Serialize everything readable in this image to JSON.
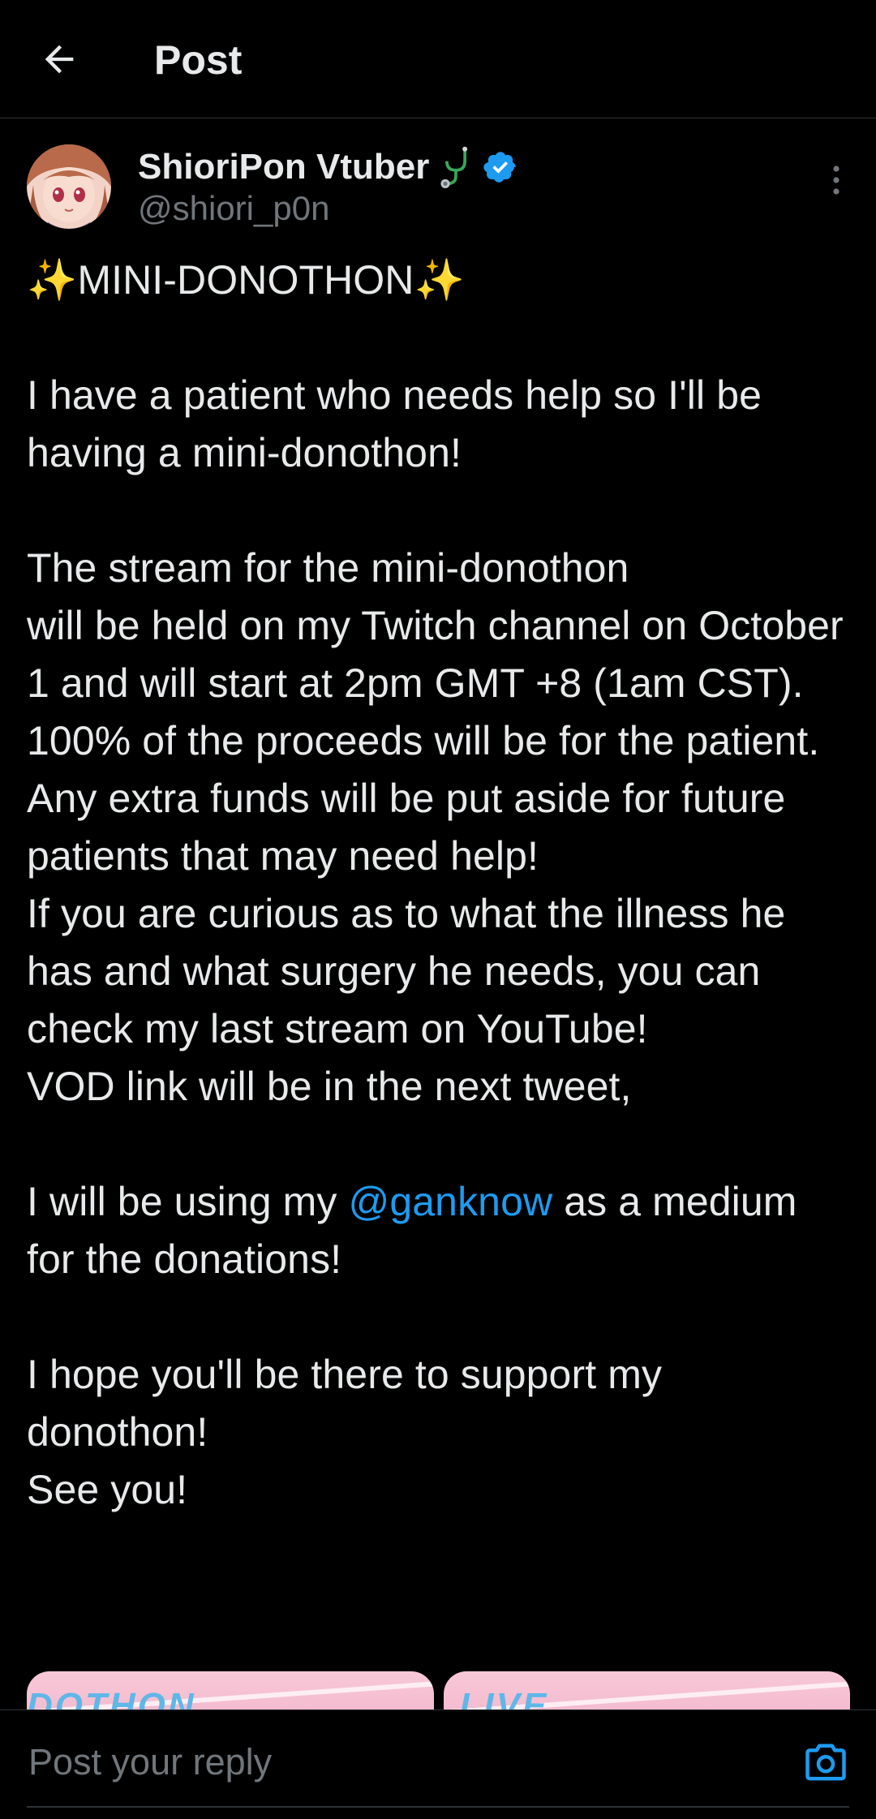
{
  "header": {
    "title": "Post",
    "back_icon": "arrow-left-icon"
  },
  "author": {
    "display_name": "ShioriPon Vtuber",
    "name_emoji": "stethoscope-icon",
    "verified_icon": "verified-badge-icon",
    "handle": "@shiori_p0n",
    "more_icon": "more-vertical-icon"
  },
  "post": {
    "p1": "✨MINI-DONOTHON✨\n\nI have a patient who needs help so I'll be having a mini-donothon!\n\nThe stream for the mini-donothon\nwill be held on my Twitch channel on October 1 and will start at 2pm GMT +8 (1am CST).\n100% of the proceeds will be for the patient. Any extra funds will be put aside for future patients that may need help!\nIf you are curious as to what the illness he has and what surgery he needs, you can check my last stream on YouTube!\nVOD link will be in the next tweet,\n\nI will be using my ",
    "mention": "@ganknow",
    "p2": " as a medium for the donations!\n\nI hope you'll be there to support my donothon!\nSee you!"
  },
  "media": {
    "tile1_word": "DOTHON",
    "tile2_word": "LIVE"
  },
  "reply": {
    "placeholder": "Post your reply",
    "camera_icon": "camera-icon"
  },
  "colors": {
    "background": "#000000",
    "text": "#e7e9ea",
    "secondary": "#71767b",
    "accent": "#1d9bf0",
    "divider": "#2f3336"
  }
}
